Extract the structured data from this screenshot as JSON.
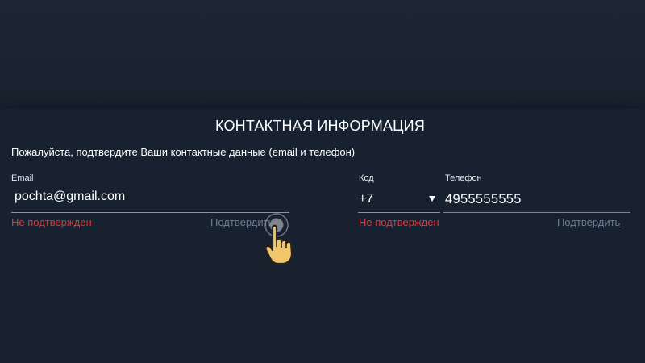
{
  "form": {
    "title": "КОНТАКТНАЯ ИНФОРМАЦИЯ",
    "subtitle": "Пожалуйста, подтвердите Ваши контактные данные (email и телефон)",
    "email": {
      "label": "Email",
      "value": "pochta@gmail.com",
      "status": "Не подтвержден",
      "confirm_label": "Подтвердить"
    },
    "code": {
      "label": "Код",
      "value": "+7"
    },
    "phone": {
      "label": "Телефон",
      "value": "4955555555",
      "status": "Не подтвержден",
      "confirm_label": "Подтвердить"
    }
  },
  "colors": {
    "background": "#18202d",
    "error": "#e0353d",
    "link": "#6f7c90",
    "active_underline": "#39b54a"
  },
  "icons": {
    "cursor": "pointing-hand-icon",
    "dropdown": "triangle-down-icon"
  }
}
